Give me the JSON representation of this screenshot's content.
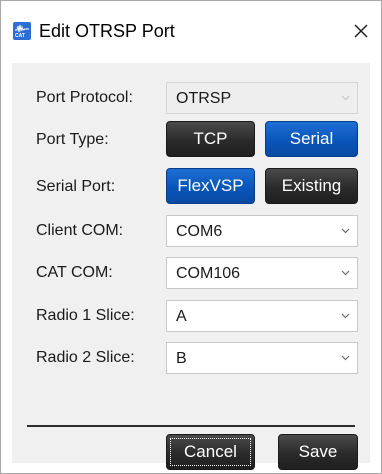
{
  "window": {
    "title": "Edit OTRSP Port",
    "app_icon": "flex-radio-app-icon",
    "app_icon_tag": "CAT",
    "close_glyph": "✕"
  },
  "form": {
    "port_protocol": {
      "label": "Port Protocol:",
      "value": "OTRSP",
      "disabled": true
    },
    "port_type": {
      "label": "Port Type:",
      "options": [
        "TCP",
        "Serial"
      ],
      "selected": "Serial"
    },
    "serial_port": {
      "label": "Serial Port:",
      "options": [
        "FlexVSP",
        "Existing"
      ],
      "selected": "FlexVSP"
    },
    "client_com": {
      "label": "Client COM:",
      "value": "COM6"
    },
    "cat_com": {
      "label": "CAT COM:",
      "value": "COM106"
    },
    "radio1_slice": {
      "label": "Radio 1 Slice:",
      "value": "A"
    },
    "radio2_slice": {
      "label": "Radio 2 Slice:",
      "value": "B"
    }
  },
  "footer": {
    "cancel_label": "Cancel",
    "save_label": "Save"
  },
  "colors": {
    "selected_button": "#0a55b8",
    "unselected_button": "#2b2b2b",
    "panel_background": "#f0f0f0"
  }
}
